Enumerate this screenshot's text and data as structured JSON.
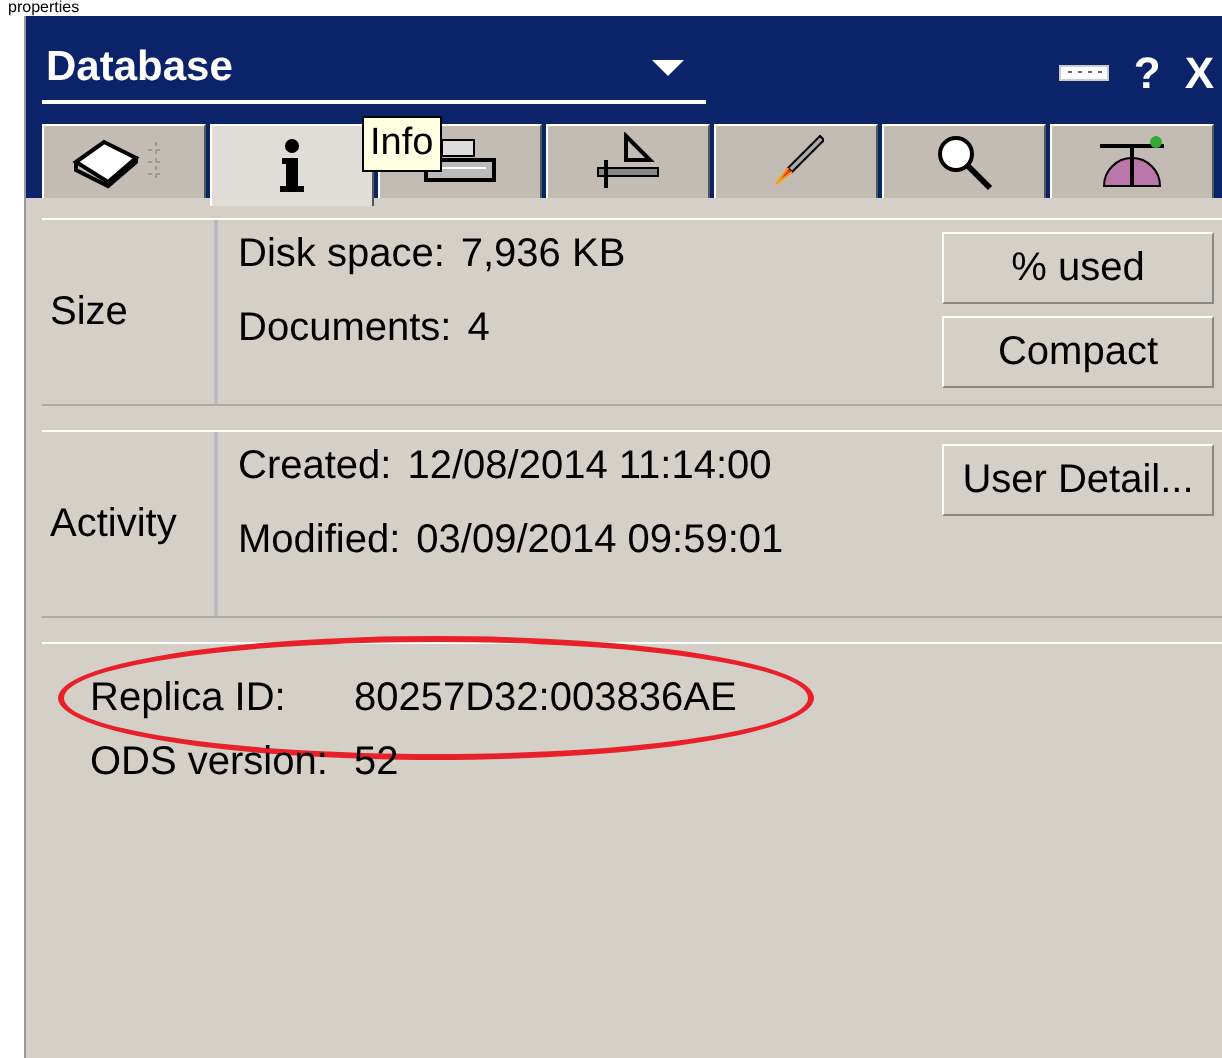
{
  "caption": "properties",
  "window": {
    "title": "Database",
    "controls": [
      "?",
      "X"
    ]
  },
  "tabs": [
    {
      "selected": false
    },
    {
      "selected": true
    },
    {
      "selected": false
    },
    {
      "selected": false
    },
    {
      "selected": false
    },
    {
      "selected": false
    },
    {
      "selected": false
    }
  ],
  "tooltip": {
    "text": "Info"
  },
  "sections": [
    {
      "label": "Size",
      "fields": [
        {
          "label": "Disk space:",
          "value": "7,936 KB"
        },
        {
          "label": "Documents:",
          "value": "4"
        }
      ],
      "buttons": [
        "% used",
        "Compact"
      ]
    },
    {
      "label": "Activity",
      "fields": [
        {
          "label": "Created:",
          "value": "12/08/2014 11:14:00"
        },
        {
          "label": "Modified:",
          "value": "03/09/2014 09:59:01"
        }
      ],
      "buttons": [
        "User Detail..."
      ]
    }
  ],
  "details": [
    {
      "label": "Replica ID:",
      "value": "80257D32:003836AE",
      "highlighted": true
    },
    {
      "label": "ODS version:",
      "value": "52",
      "highlighted": false
    }
  ]
}
